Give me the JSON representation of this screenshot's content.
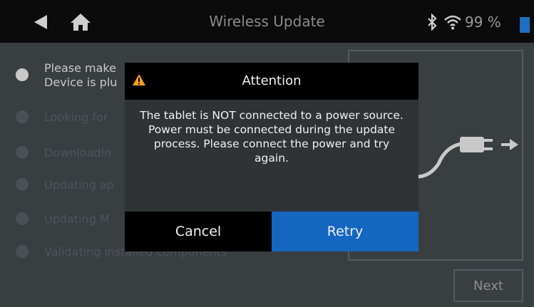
{
  "topbar": {
    "title": "Wireless Update",
    "battery_percent": "99 %",
    "icons": {
      "back": "back-arrow-icon",
      "home": "home-icon",
      "bluetooth": "bluetooth-icon",
      "wifi": "wifi-icon",
      "battery": "battery-icon"
    }
  },
  "steps": [
    {
      "label_line1": "Please make",
      "label_line2": "Device is plu",
      "active": true
    },
    {
      "label": "Looking for"
    },
    {
      "label": "Downloadin"
    },
    {
      "label": "Updating ap"
    },
    {
      "label": "Updating M"
    },
    {
      "label": "Validating installed components"
    }
  ],
  "next_label": "Next",
  "dialog": {
    "title": "Attention",
    "message": "The tablet is NOT connected to a power source. Power must be connected during the update process. Please connect the power and try again.",
    "cancel_label": "Cancel",
    "retry_label": "Retry"
  },
  "colors": {
    "accent_blue": "#1566c0",
    "warning": "#f0a020",
    "header_bg": "#0b0b0b",
    "dim_bg": "#393e41"
  }
}
